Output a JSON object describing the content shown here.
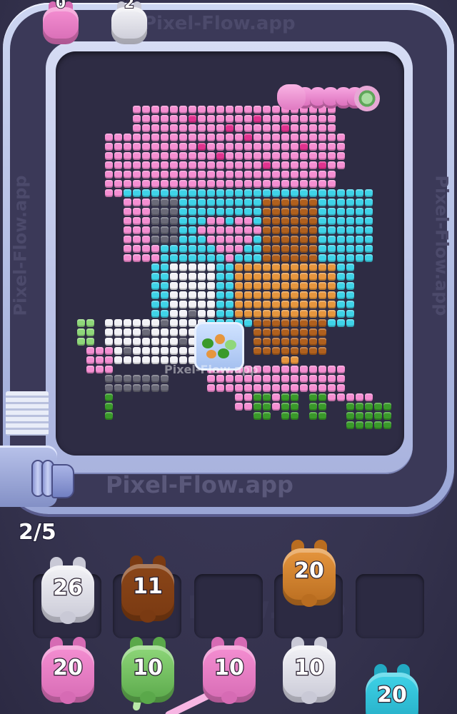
{
  "game": {
    "watermark": "Pixel-Flow.app",
    "watermark_center": "Pixel-Flow.app",
    "watermark_tray": "Flow.app",
    "level_progress": "2/5",
    "top_queue": [
      {
        "count": "0",
        "color": "pink"
      },
      {
        "count": "2",
        "color": "white"
      }
    ],
    "tray_slots": [
      {
        "count": "26",
        "color": "white"
      },
      {
        "count": "11",
        "color": "brown"
      },
      {
        "count": "",
        "color": "empty"
      },
      {
        "count": "20",
        "color": "orange"
      },
      {
        "count": "",
        "color": "empty"
      }
    ],
    "shooters": [
      {
        "count": "20",
        "color": "pink"
      },
      {
        "count": "10",
        "color": "green"
      },
      {
        "count": "10",
        "color": "pink"
      },
      {
        "count": "10",
        "color": "white"
      },
      {
        "count": "20",
        "color": "cyan"
      }
    ],
    "colors": {
      "pink": "#f58fd2",
      "hot_pink": "#e0338f",
      "cyan": "#3fd3e8",
      "white": "#f2f2f6",
      "gray": "#6a6a78",
      "brown": "#b0601e",
      "orange": "#e6963e",
      "green": "#8fd77a",
      "dark_green": "#3a9a2a"
    }
  }
}
